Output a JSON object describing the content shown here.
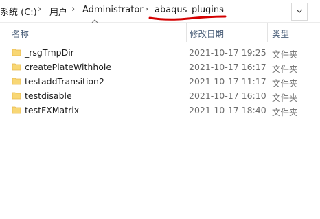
{
  "breadcrumb": {
    "items": [
      "系统 (C:)",
      "用户",
      "Administrator",
      "abaqus_plugins"
    ]
  },
  "icons": {
    "separator": "chevron-right-icon",
    "dropdown": "chevron-down-icon",
    "folder": "folder-icon",
    "sort": "sort-ascending-icon"
  },
  "annotation": {
    "color": "#d40000"
  },
  "columns": {
    "name": "名称",
    "date_modified": "修改日期",
    "type": "类型"
  },
  "files": [
    {
      "name": "_rsgTmpDir",
      "date": "2021-10-17 19:25",
      "type": "文件夹"
    },
    {
      "name": "createPlateWithhole",
      "date": "2021-10-17 16:17",
      "type": "文件夹"
    },
    {
      "name": "testaddTransition2",
      "date": "2021-10-17 11:17",
      "type": "文件夹"
    },
    {
      "name": "testdisable",
      "date": "2021-10-17 16:10",
      "type": "文件夹"
    },
    {
      "name": "testFXMatrix",
      "date": "2021-10-17 18:40",
      "type": "文件夹"
    }
  ],
  "colors": {
    "folder": "#f8d775",
    "folder_dark": "#e8b84a",
    "header_text": "#4c607a"
  }
}
